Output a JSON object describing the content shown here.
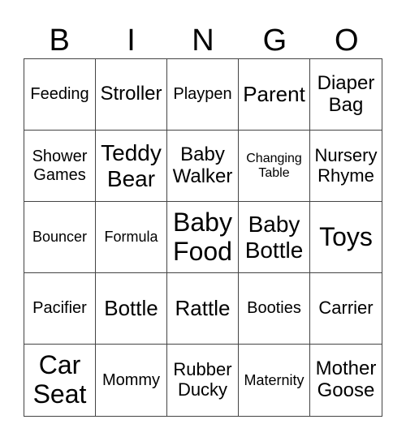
{
  "header": {
    "letters": [
      "B",
      "I",
      "N",
      "G",
      "O"
    ]
  },
  "cells": [
    "Feeding",
    "Stroller",
    "Playpen",
    "Parent",
    "Diaper\nBag",
    "Shower\nGames",
    "Teddy\nBear",
    "Baby\nWalker",
    "Changing\nTable",
    "Nursery\nRhyme",
    "Bouncer",
    "Formula",
    "Baby\nFood",
    "Baby\nBottle",
    "Toys",
    "Pacifier",
    "Bottle",
    "Rattle",
    "Booties",
    "Carrier",
    "Car\nSeat",
    "Mommy",
    "Rubber\nDucky",
    "Maternity",
    "Mother\nGoose"
  ]
}
